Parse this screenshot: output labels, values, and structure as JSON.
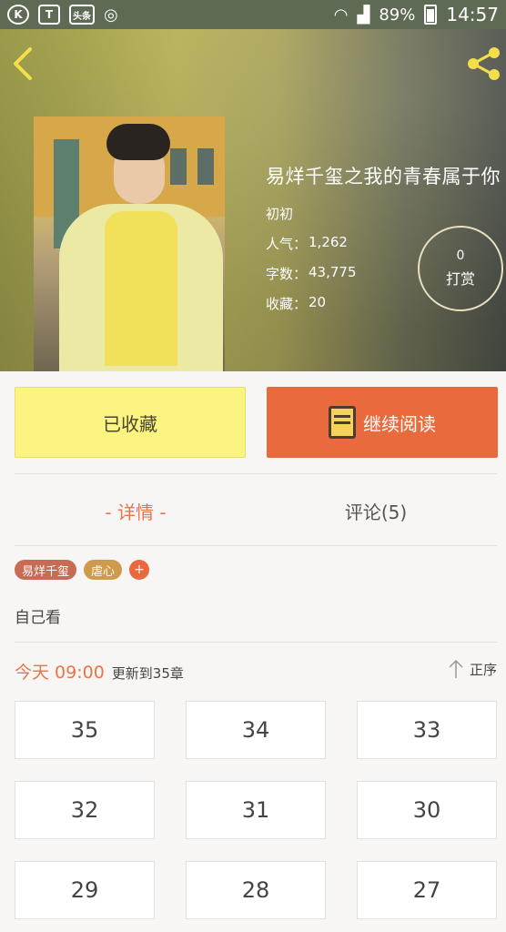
{
  "status_bar": {
    "battery": "89%",
    "time": "14:57",
    "left_icons": [
      "k-circle-icon",
      "shield-icon",
      "toutiao-icon",
      "weibo-icon"
    ],
    "toutiao_label": "头条"
  },
  "header": {
    "back_icon": "chevron-left-icon",
    "share_icon": "share-icon"
  },
  "book": {
    "title": "易烊千玺之我的青春属于你",
    "author": "初初",
    "popularity_label": "人气：",
    "popularity": "1,262",
    "words_label": "字数：",
    "words": "43,775",
    "favorites_label": "收藏：",
    "favorites": "20"
  },
  "tip": {
    "count": "0",
    "label": "打赏"
  },
  "actions": {
    "favorited_label": "已收藏",
    "continue_label": "继续阅读"
  },
  "tabs": {
    "details": "- 详情 -",
    "comments": "评论(5)"
  },
  "tags": [
    "易烊千玺",
    "虐心"
  ],
  "tag_add": "+",
  "description": "自己看",
  "update": {
    "time": "今天 09:00",
    "text": "更新到35章",
    "sort_label": "正序"
  },
  "chapters": [
    "35",
    "34",
    "33",
    "32",
    "31",
    "30",
    "29",
    "28",
    "27"
  ],
  "colors": {
    "accent": "#e8754a",
    "read_button": "#e96a3d",
    "fav_button": "#fbf480"
  }
}
